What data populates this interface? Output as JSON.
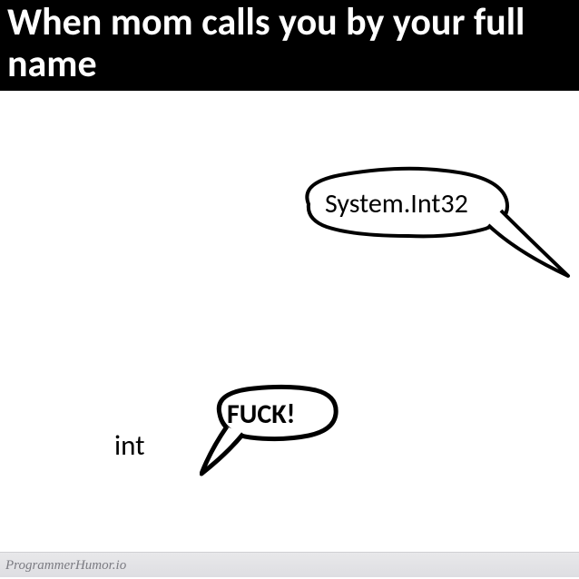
{
  "header": {
    "title": "When mom calls you by your full name"
  },
  "bubbles": {
    "mom": "System.Int32",
    "child_reaction": "FUCK!"
  },
  "child_label": "int",
  "footer": {
    "source": "ProgrammerHumor.io"
  }
}
